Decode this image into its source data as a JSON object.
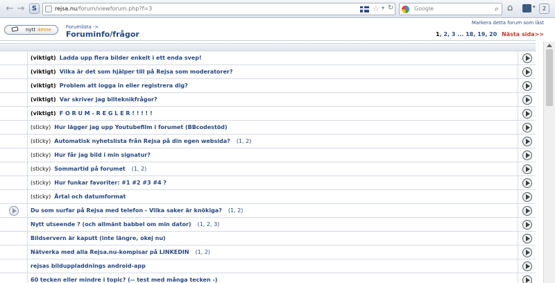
{
  "browser": {
    "url_host": "rejsa.nu",
    "url_path": "/forum/viewforum.php?f=3",
    "site_icon_label": "S",
    "search_placeholder": "Google",
    "badge_count": "2"
  },
  "header": {
    "new_topic_label": "nytt",
    "new_topic_accent": "ämne",
    "breadcrumb": "Forumlista  ->",
    "title": "Foruminfo/frågor",
    "mark_read": "Markera detta forum som läst",
    "pager": {
      "pages": [
        "1",
        "2",
        "3",
        "...",
        "18",
        "19",
        "20"
      ],
      "current": "1",
      "next": "Nästa sida>>"
    }
  },
  "topics": [
    {
      "tag": "(viktigt)",
      "important": true,
      "title": "Ladda upp flera bilder enkelt i ett enda svep!",
      "pages": ""
    },
    {
      "tag": "(viktigt)",
      "important": true,
      "title": "Vilka är det som hjälper till på Rejsa som moderatorer?",
      "pages": ""
    },
    {
      "tag": "(viktigt)",
      "important": true,
      "title": "Problem att logga in eller registrera dig?",
      "pages": ""
    },
    {
      "tag": "(viktigt)",
      "important": true,
      "title": "Var skriver jag bilteknikfrågor?",
      "pages": ""
    },
    {
      "tag": "(viktigt)",
      "important": true,
      "title": "F O R U M - R E G L E R ! ! ! ! !",
      "pages": ""
    },
    {
      "tag": "(sticky)",
      "important": false,
      "title": "Hur lägger jag upp Youtubefilm i forumet (BBcodestöd)",
      "pages": ""
    },
    {
      "tag": "(sticky)",
      "important": false,
      "title": "Automatisk nyhetslista från Rejsa på din egen websida?",
      "pages": "(1, 2)"
    },
    {
      "tag": "(sticky)",
      "important": false,
      "title": "Hur får jag bild i min signatur?",
      "pages": ""
    },
    {
      "tag": "(sticky)",
      "important": false,
      "title": "Sommartid på forumet",
      "pages": "(1, 2)"
    },
    {
      "tag": "(sticky)",
      "important": false,
      "title": "Hur funkar favoriter: #1 #2 #3 #4 ?",
      "pages": ""
    },
    {
      "tag": "(sticky)",
      "important": false,
      "title": "Årtal och datumformat",
      "pages": ""
    },
    {
      "tag": "",
      "important": false,
      "title": "Du som surfar på Rejsa med telefon - Vilka saker är knökiga?",
      "pages": "(1, 2)",
      "unread_icon": true
    },
    {
      "tag": "",
      "important": false,
      "title": "Nytt utseende ? (och allmänt babbel om min dator)",
      "pages": "(1, 2, 3)"
    },
    {
      "tag": "",
      "important": false,
      "title": "Bildservern är kaputt (inte längre, okej nu)",
      "pages": ""
    },
    {
      "tag": "",
      "important": false,
      "title": "Nätverka med alla Rejsa.nu-kompisar på LINKEDIN",
      "pages": "(1, 2)"
    },
    {
      "tag": "",
      "important": false,
      "title": "rejsas bilduppladdnings android-app",
      "pages": ""
    },
    {
      "tag": "",
      "important": false,
      "title": "60 tecken eller mindre i topic? (-- test med många tecken -)",
      "pages": ""
    }
  ]
}
